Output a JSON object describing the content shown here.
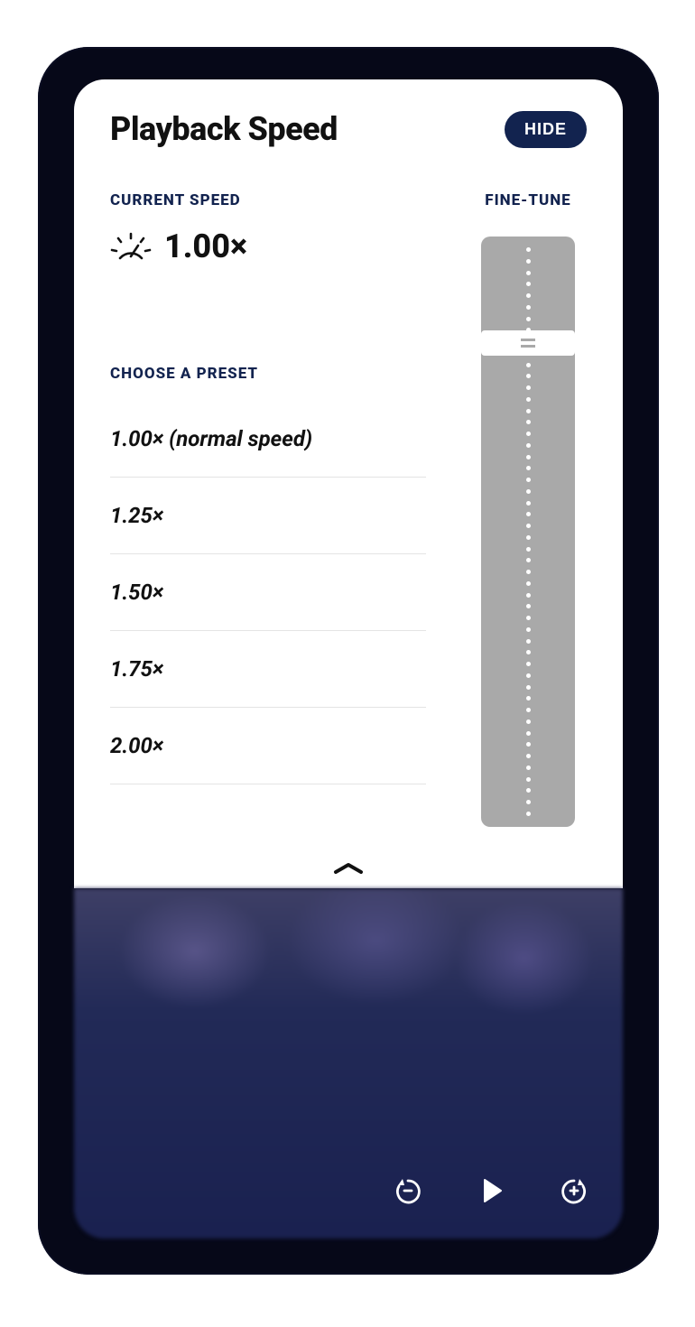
{
  "header": {
    "title": "Playback Speed",
    "hide_label": "HIDE"
  },
  "current": {
    "label": "CURRENT SPEED",
    "value": "1.00×"
  },
  "presets": {
    "label": "CHOOSE A PRESET",
    "items": [
      "1.00× (normal speed)",
      "1.25×",
      "1.50×",
      "1.75×",
      "2.00×"
    ]
  },
  "fine_tune": {
    "label": "FINE-TUNE"
  }
}
